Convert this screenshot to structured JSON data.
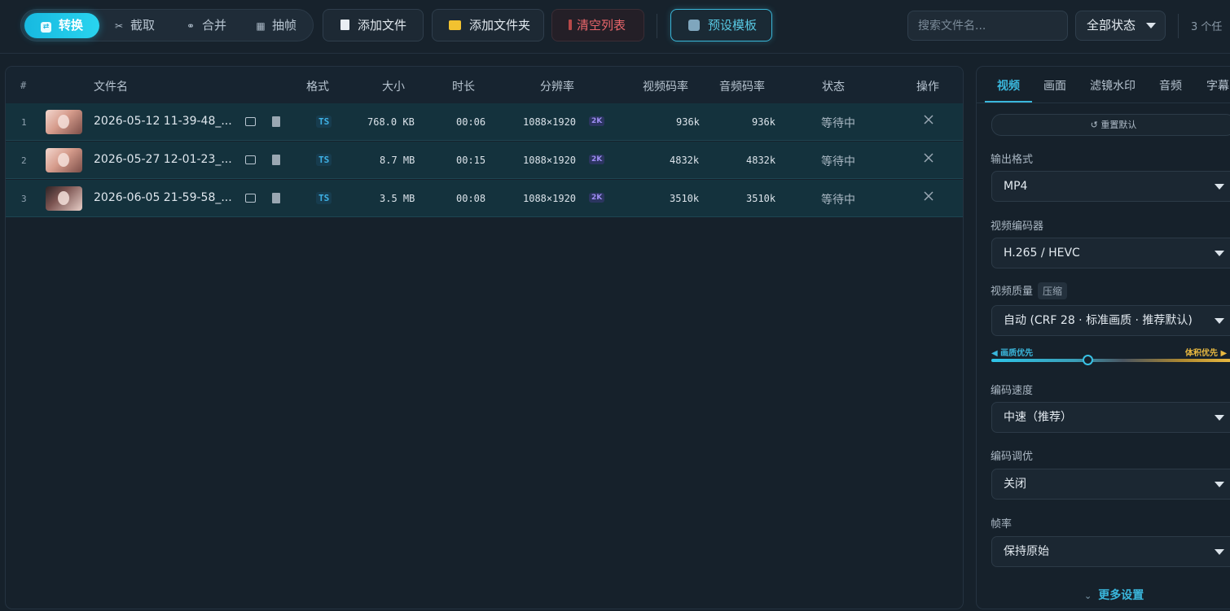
{
  "toolbar": {
    "modes": [
      {
        "label": "转换",
        "icon": "convert-icon"
      },
      {
        "label": "截取",
        "icon": "scissors-icon"
      },
      {
        "label": "合并",
        "icon": "link-icon"
      },
      {
        "label": "抽帧",
        "icon": "frames-icon"
      }
    ],
    "add_file_label": "添加文件",
    "add_folder_label": "添加文件夹",
    "clear_list_label": "清空列表",
    "preset_label": "预设模板",
    "search_placeholder": "搜索文件名...",
    "status_filter": "全部状态",
    "task_count": "3 个任"
  },
  "table": {
    "columns": {
      "index": "#",
      "filename": "文件名",
      "format": "格式",
      "size": "大小",
      "duration": "时长",
      "resolution": "分辨率",
      "video_bitrate": "视频码率",
      "audio_bitrate": "音频码率",
      "status": "状态",
      "actions": "操作"
    },
    "rows": [
      {
        "index": "1",
        "filename": "2026-05-12 11-39-48_...",
        "format": "TS",
        "size": "768.0 KB",
        "duration": "00:06",
        "resolution": "1088×1920",
        "res_badge": "2K",
        "video_bitrate": "936k",
        "audio_bitrate": "936k",
        "status": "等待中"
      },
      {
        "index": "2",
        "filename": "2026-05-27 12-01-23_...",
        "format": "TS",
        "size": "8.7 MB",
        "duration": "00:15",
        "resolution": "1088×1920",
        "res_badge": "2K",
        "video_bitrate": "4832k",
        "audio_bitrate": "4832k",
        "status": "等待中"
      },
      {
        "index": "3",
        "filename": "2026-06-05 21-59-58_...",
        "format": "TS",
        "size": "3.5 MB",
        "duration": "00:08",
        "resolution": "1088×1920",
        "res_badge": "2K",
        "video_bitrate": "3510k",
        "audio_bitrate": "3510k",
        "status": "等待中"
      }
    ]
  },
  "settings": {
    "tabs": [
      "视频",
      "画面",
      "滤镜水印",
      "音频",
      "字幕"
    ],
    "active_tab": "视频",
    "reset_label": "↺ 重置默认",
    "output_format": {
      "label": "输出格式",
      "value": "MP4"
    },
    "video_encoder": {
      "label": "视频编码器",
      "value": "H.265 / HEVC"
    },
    "video_quality": {
      "label": "视频质量",
      "tag": "压缩",
      "value": "自动 (CRF 28 · 标准画质 · 推荐默认)"
    },
    "quality_slider": {
      "left_label": "◀ 画质优先",
      "right_label": "体积优先 ▶",
      "level": 0.4
    },
    "encode_speed": {
      "label": "编码速度",
      "value": "中速（推荐）"
    },
    "encode_tune": {
      "label": "编码调优",
      "value": "关闭"
    },
    "frame_rate": {
      "label": "帧率",
      "value": "保持原始"
    },
    "more_settings_label": "更多设置"
  },
  "colors": {
    "accent": "#3ab7dc",
    "background": "#16212b",
    "row_highlight": "#14323d",
    "danger": "#e9666b",
    "warning": "#e9b940"
  }
}
